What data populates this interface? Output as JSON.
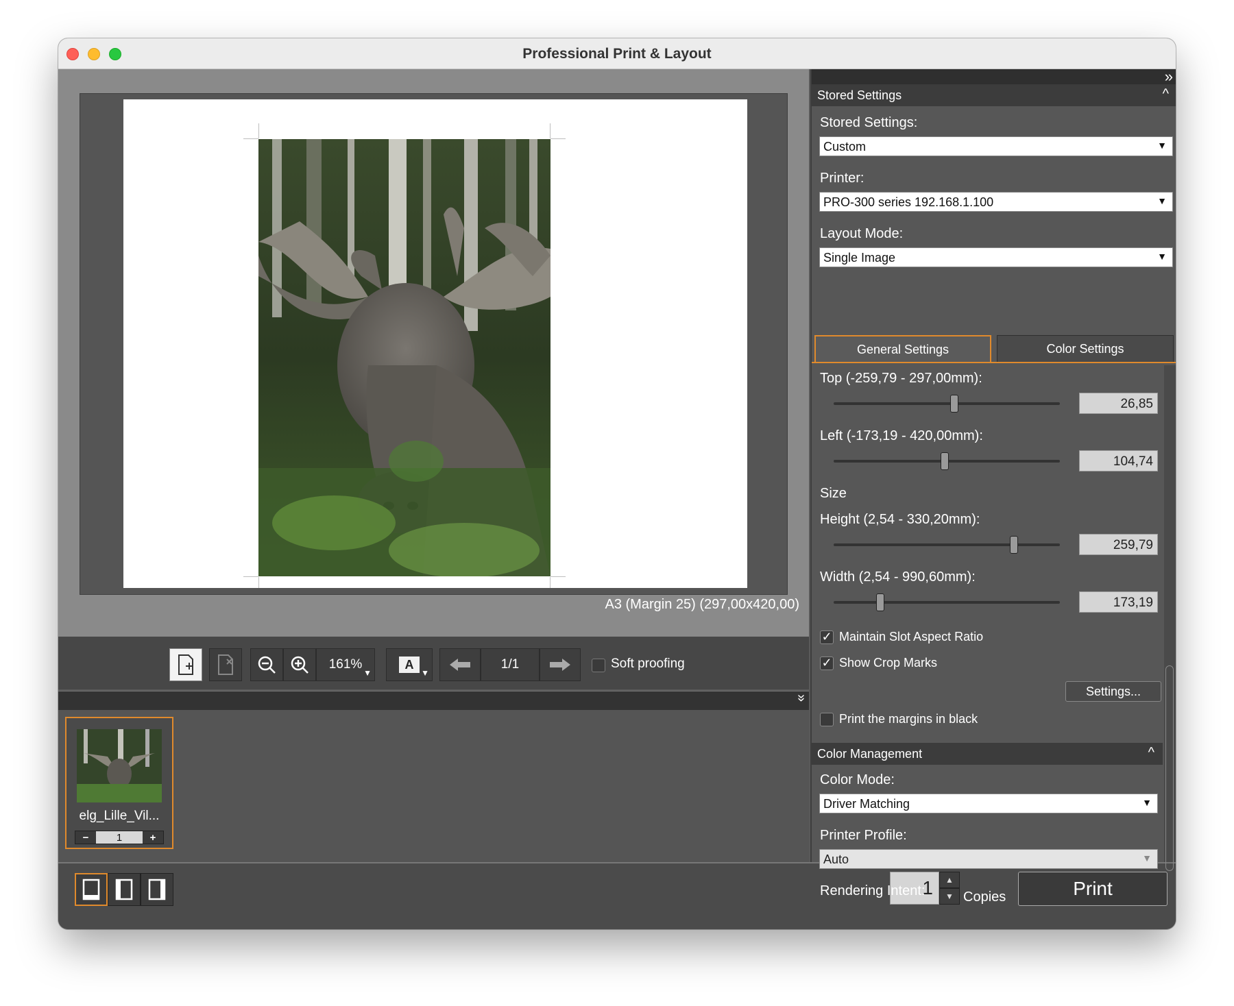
{
  "window": {
    "title": "Professional Print & Layout"
  },
  "preview": {
    "page_info": "A3 (Margin 25) (297,00x420,00)"
  },
  "toolbar": {
    "zoom": "161%",
    "page_counter": "1/1",
    "soft_proofing_label": "Soft proofing",
    "soft_proofing_checked": false
  },
  "thumbnails": [
    {
      "name": "elg_Lille_Vil...",
      "copies": "1",
      "minus": "−",
      "plus": "+"
    }
  ],
  "bottom": {
    "copies_value": "1",
    "copies_label": "Copies",
    "print_label": "Print"
  },
  "panel": {
    "stored_settings_section": "Stored Settings",
    "stored_settings_label": "Stored Settings:",
    "stored_settings_value": "Custom",
    "printer_label": "Printer:",
    "printer_value": "PRO-300 series 192.168.1.100",
    "layout_mode_label": "Layout Mode:",
    "layout_mode_value": "Single Image",
    "tabs": [
      "General Settings",
      "Color Settings"
    ],
    "top_label": "Top (-259,79 - 297,00mm):",
    "top_value": "26,85",
    "left_label": "Left (-173,19 - 420,00mm):",
    "left_value": "104,74",
    "size_label": "Size",
    "height_label": "Height (2,54 - 330,20mm):",
    "height_value": "259,79",
    "width_label": "Width (2,54 - 990,60mm):",
    "width_value": "173,19",
    "maintain_aspect_label": "Maintain Slot Aspect Ratio",
    "maintain_aspect_checked": true,
    "show_crop_marks_label": "Show Crop Marks",
    "show_crop_marks_checked": true,
    "settings_button": "Settings...",
    "print_margins_black_label": "Print the margins in black",
    "print_margins_black_checked": false,
    "color_management_section": "Color Management",
    "color_mode_label": "Color Mode:",
    "color_mode_value": "Driver Matching",
    "printer_profile_label": "Printer Profile:",
    "printer_profile_value": "Auto",
    "rendering_intent_label": "Rendering Intent:"
  },
  "colors": {
    "accent": "#e08a2c",
    "panel_bg": "#575757",
    "preview_bg": "#8a8a8a"
  }
}
